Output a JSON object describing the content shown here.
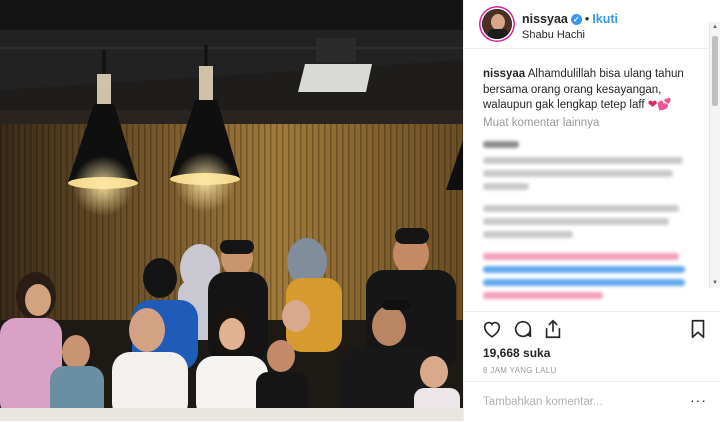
{
  "post": {
    "username": "nissyaa",
    "follow_label": "Ikuti",
    "dot": "•",
    "location": "Shabu Hachi",
    "verified_glyph": "✓",
    "caption_text": "Alhamdulillah bisa ulang tahun bersama orang orang kesayangan, walaupun gak lengkap tetep laff",
    "caption_emoji": "❤💕",
    "load_more_label": "Muat komentar lainnya",
    "likes": "19,668 suka",
    "timestamp": "8 JAM YANG LALU",
    "add_comment_placeholder": "Tambahkan komentar...",
    "options_glyph": "···"
  },
  "icons": [
    "heart-icon",
    "comment-icon",
    "share-icon",
    "bookmark-icon"
  ],
  "colors": {
    "accent": "#3897f0",
    "heart": "#e0245e",
    "muted": "#999999"
  }
}
